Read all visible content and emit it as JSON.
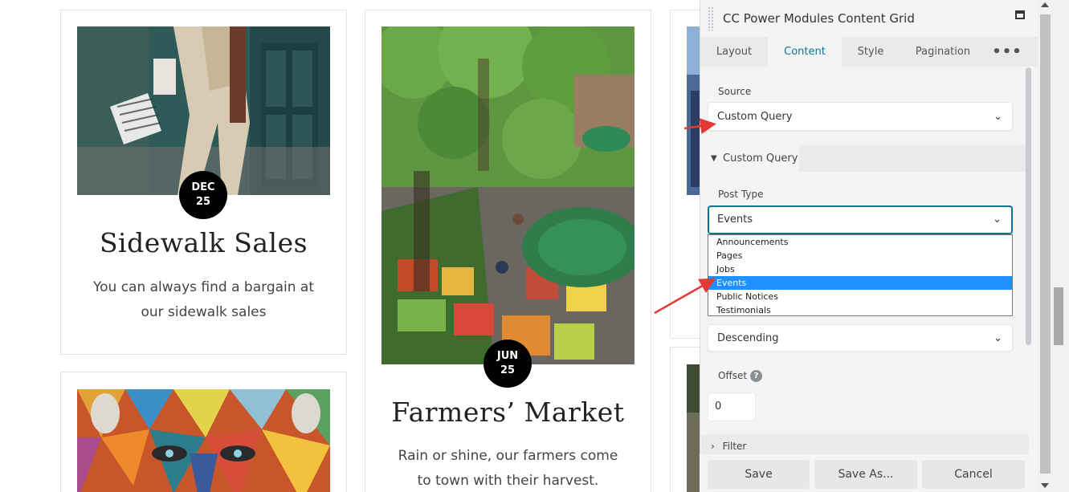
{
  "cards": [
    {
      "title": "Sidewalk Sales",
      "text": "You can always find a bargain at our sidewalk sales",
      "month": "DEC",
      "day": "25"
    },
    {
      "title": "Farmers’ Market",
      "text": "Rain or shine, our farmers come to town with their harvest.",
      "month": "JUN",
      "day": "25"
    }
  ],
  "panel": {
    "title": "CC Power Modules Content Grid",
    "tabs": [
      "Layout",
      "Content",
      "Style",
      "Pagination",
      "•••"
    ],
    "active_tab": "Content",
    "source_label": "Source",
    "source_value": "Custom Query",
    "section_label": "Custom Query",
    "post_type_label": "Post Type",
    "post_type_value": "Events",
    "post_type_options": [
      "Announcements",
      "Pages",
      "Jobs",
      "Events",
      "Public Notices",
      "Testimonials"
    ],
    "order_value": "Descending",
    "offset_label": "Offset",
    "offset_value": "0",
    "filter_label": "Filter",
    "buttons": {
      "save": "Save",
      "save_as": "Save As...",
      "cancel": "Cancel"
    }
  },
  "colors": {
    "accent": "#0e7490",
    "annotation_arrow": "#e53935",
    "selected_option": "#1e90ff"
  }
}
